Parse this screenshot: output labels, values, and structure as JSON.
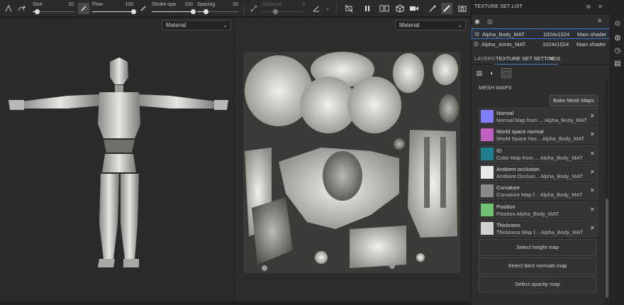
{
  "toolbar": {
    "size": {
      "label": "Size",
      "value": "10",
      "level": 0.1
    },
    "flow": {
      "label": "Flow",
      "value": "100",
      "level": 1.0
    },
    "stroke_opacity": {
      "label": "Stroke opa",
      "value": "100",
      "level": 1.0
    },
    "spacing": {
      "label": "Spacing",
      "value": "20",
      "level": 0.2
    },
    "distance": {
      "label": "Distance",
      "value": "3",
      "level": 0.3
    }
  },
  "viewport_3d": {
    "channel": "Material"
  },
  "viewport_2d": {
    "channel": "Material"
  },
  "texture_set_list": {
    "title": "TEXTURE SET LIST",
    "rows": [
      {
        "name": "Alpha_Body_MAT",
        "size": "1024x1024",
        "shader": "Main shader",
        "selected": true
      },
      {
        "name": "Alpha_Joints_MAT",
        "size": "1024x1024",
        "shader": "Main shader",
        "selected": false
      }
    ]
  },
  "tabs": [
    {
      "label": "LAYERS",
      "active": false
    },
    {
      "label": "TEXTURE SET SETTINGS",
      "active": true
    }
  ],
  "mesh_maps": {
    "title": "MESH MAPS",
    "bake_button": "Bake Mesh Maps",
    "items": [
      {
        "name": "Normal",
        "sub": "Normal Map from ... Alpha_Body_MAT",
        "color": "#7f7fff"
      },
      {
        "name": "World space normal",
        "sub": "World Space Nor... Alpha_Body_MAT",
        "color": "#c060c0"
      },
      {
        "name": "ID",
        "sub": "Color Map from ... Alpha_Body_MAT",
        "color": "#1f7f8f"
      },
      {
        "name": "Ambient occlusion",
        "sub": "Ambient Occlusi... Alpha_Body_MAT",
        "color": "#e8e8e8"
      },
      {
        "name": "Curvature",
        "sub": "Curvature Map f... Alpha_Body_MAT",
        "color": "#8a8a8a"
      },
      {
        "name": "Position",
        "sub": "Position Alpha_Body_MAT",
        "color": "#70c070"
      },
      {
        "name": "Thickness",
        "sub": "Thickness Map f... Alpha_Body_MAT",
        "color": "#d0d0d0"
      }
    ],
    "buttons": [
      "Select height map",
      "Select bent normals map",
      "Select opacity map"
    ]
  }
}
